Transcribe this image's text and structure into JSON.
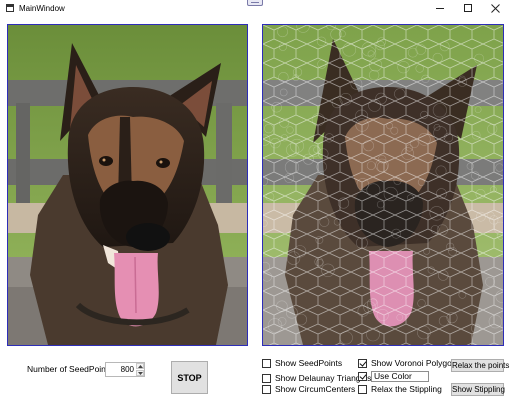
{
  "window": {
    "title": "MainWindow",
    "icon": "window-icon",
    "controls": [
      "minimize-icon",
      "maximize-icon",
      "close-icon"
    ]
  },
  "images": {
    "original": "photograph of a German Shepherd dog with pink tongue out, green foliage background",
    "stippled": "Voronoi polygon mosaic rendering of the dog photograph"
  },
  "colors": {
    "panel_border": "#2d2db8",
    "button_face": "#e1e1e1"
  },
  "controls": {
    "seed_label": "Number of SeedPoints:",
    "seed_value": "800",
    "stop_label": "STOP",
    "show_seedpoints": {
      "label": "Show SeedPoints",
      "checked": false
    },
    "show_delaunay": {
      "label": "Show Delaunay Triangles",
      "checked": false
    },
    "show_circumcenters": {
      "label": "Show CircumCenters",
      "checked": false
    },
    "show_voronoi": {
      "label": "Show Voronoi Polygons",
      "checked": true
    },
    "use_color": {
      "label": "Use Color",
      "checked": true
    },
    "relax_stippling": {
      "label": "Relax the Stippling",
      "checked": false
    },
    "relax_points_label": "Relax the points",
    "show_stippling_label": "Show Stippling"
  }
}
